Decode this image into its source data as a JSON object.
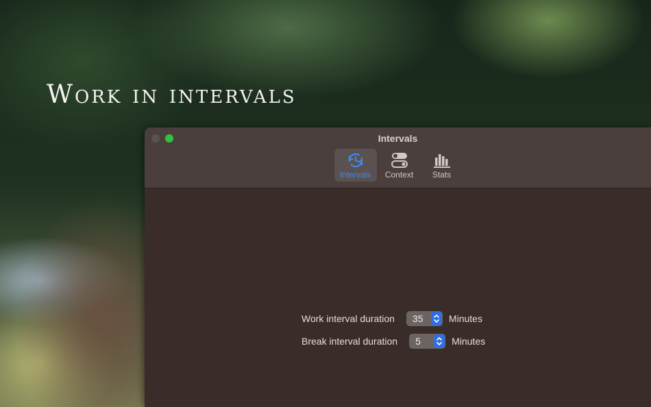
{
  "headline": "Work in intervals",
  "window": {
    "title": "Intervals",
    "tabs": [
      {
        "label": "Intervals",
        "icon": "clock-refresh-icon",
        "active": true
      },
      {
        "label": "Context",
        "icon": "toggles-icon",
        "active": false
      },
      {
        "label": "Stats",
        "icon": "bar-chart-icon",
        "active": false
      }
    ]
  },
  "settings": {
    "work": {
      "label": "Work interval duration",
      "value": "35",
      "unit": "Minutes"
    },
    "break": {
      "label": "Break interval duration",
      "value": "5",
      "unit": "Minutes"
    }
  },
  "colors": {
    "accent": "#3d8bf5",
    "window_bg": "#392c29",
    "titlebar_bg": "#4a3f3c",
    "zoom_button": "#30c23f"
  }
}
